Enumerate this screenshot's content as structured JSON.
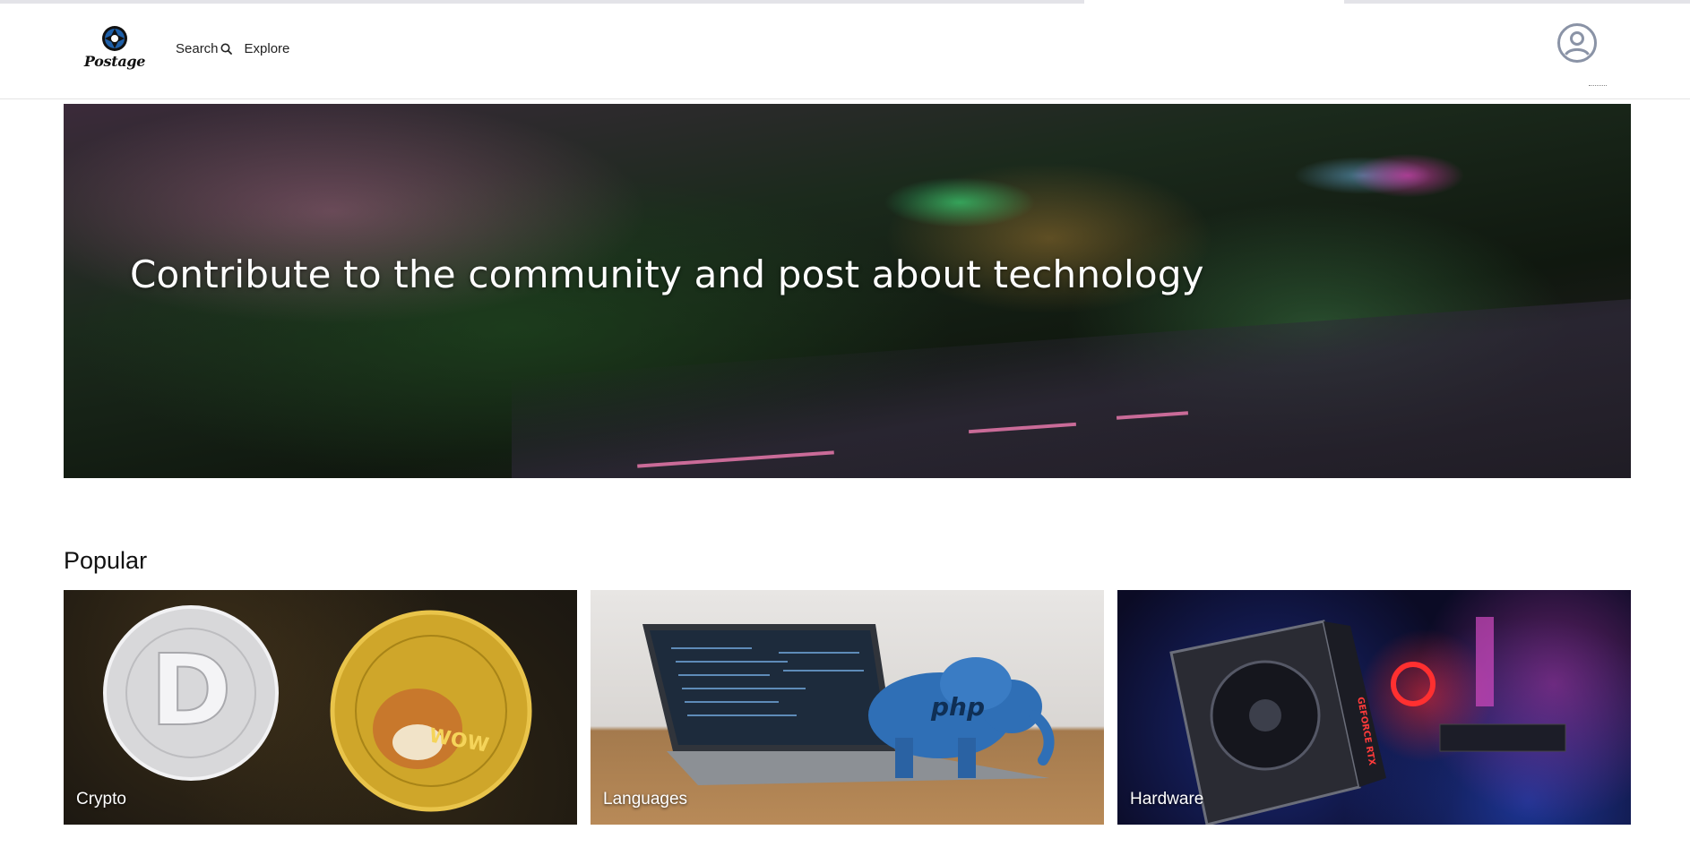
{
  "brand": {
    "name": "Postage"
  },
  "nav": {
    "search_label": "Search",
    "explore_label": "Explore"
  },
  "hero": {
    "title": "Contribute to the community and post about technology"
  },
  "popular": {
    "heading": "Popular",
    "cards": [
      {
        "label": "Crypto"
      },
      {
        "label": "Languages"
      },
      {
        "label": "Hardware"
      }
    ]
  },
  "icons": {
    "logo": "shutter-icon",
    "search": "search-icon",
    "account": "user-circle-icon"
  },
  "colors": {
    "logo_blue": "#1e5fa8",
    "avatar_gray": "#8a93a6",
    "hero_text": "#ffffff"
  }
}
